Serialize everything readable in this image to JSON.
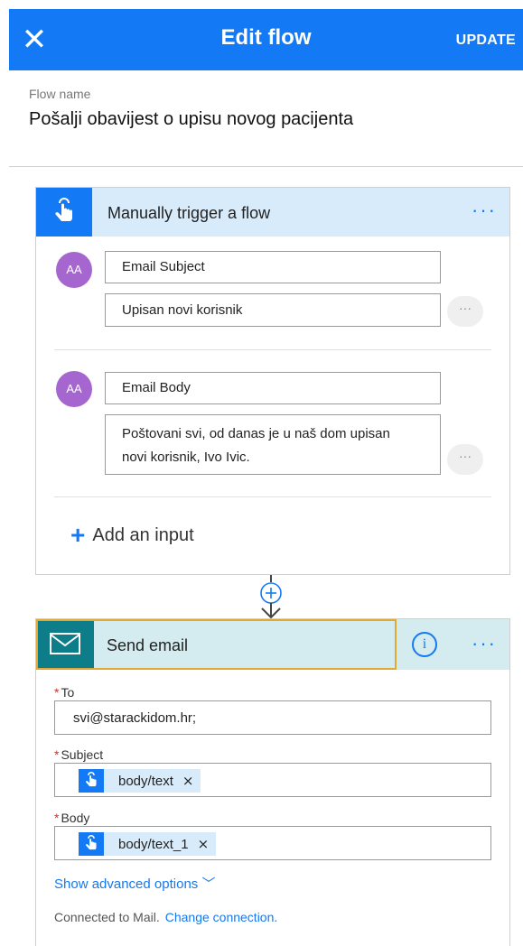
{
  "header": {
    "close_glyph": "✕",
    "title": "Edit flow",
    "update_label": "UPDATE"
  },
  "flow": {
    "name_label": "Flow name",
    "name_value": "Pošalji obavijest o upisu novog pacijenta"
  },
  "trigger": {
    "title": "Manually trigger a flow",
    "more_glyph": "···",
    "inputs": [
      {
        "avatar_text": "AA",
        "name": "Email Subject",
        "value": "Upisan novi korisnik",
        "more_glyph": "···"
      },
      {
        "avatar_text": "AA",
        "name": "Email Body",
        "value_line1": "Poštovani svi, od danas je u naš dom upisan",
        "value_line2": "novi korisnik, Ivo Ivic.",
        "more_glyph": "···"
      }
    ],
    "add_input_plus": "+",
    "add_input_label": "Add an input"
  },
  "connector": {
    "icon": "add-step-icon"
  },
  "action": {
    "title": "Send email",
    "info_glyph": "i",
    "more_glyph": "···",
    "required_marker": "*",
    "to_label": "To",
    "to_value": "svi@starackidom.hr;",
    "subject_label": "Subject",
    "subject_token": "body/text",
    "body_label": "Body",
    "body_token": "body/text_1",
    "token_remove_glyph": "×",
    "advanced_label": "Show advanced options",
    "advanced_chevron": "﹀",
    "connected_text": "Connected to Mail.",
    "change_connection_label": "Change connection."
  },
  "colors": {
    "brand_blue": "#1479f5",
    "mail_teal": "#0e7d8a",
    "avatar_purple": "#a566cf",
    "selection_orange": "#e3a832",
    "required_red": "#d0312d"
  },
  "icons": [
    "close-icon",
    "touch-trigger-icon",
    "mail-icon",
    "info-icon",
    "more-dots-icon",
    "add-step-icon",
    "chevron-down-icon",
    "remove-token-icon"
  ]
}
